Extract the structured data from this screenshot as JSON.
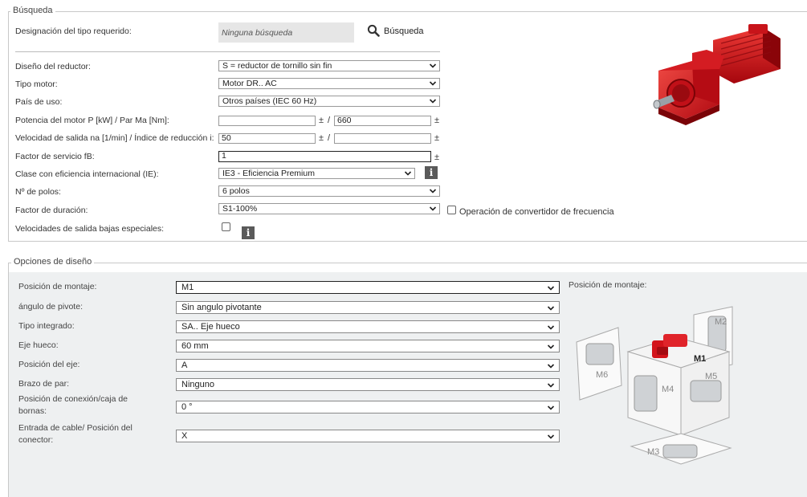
{
  "search": {
    "legend": "Búsqueda",
    "type_label": "Designación del tipo requerido:",
    "type_placeholder": "Ninguna búsqueda",
    "search_button": "Búsqueda"
  },
  "params": {
    "gear_design_label": "Diseño del reductor:",
    "gear_design_value": "S = reductor de tornillo sin fin",
    "motor_type_label": "Tipo motor:",
    "motor_type_value": "Motor DR.. AC",
    "country_label": "País de uso:",
    "country_value": "Otros países (IEC 60 Hz)",
    "motor_power_label": "Potencia del motor P [kW] / Par Ma [Nm]:",
    "motor_power_value": "",
    "torque_value": "660",
    "speed_label": "Velocidad de salida na [1/min] / Índice de reducción i:",
    "speed_value": "50",
    "ratio_value": "",
    "service_factor_label": "Factor de servicio fB:",
    "service_factor_value": "1",
    "efficiency_label": "Clase con eficiencia internacional (IE):",
    "efficiency_value": "IE3 - Eficiencia Premium",
    "poles_label": "Nº de polos:",
    "poles_value": "6 polos",
    "duty_label": "Factor de duración:",
    "duty_value": "S1-100%",
    "vfd_label": "Operación de convertidor de frecuencia",
    "low_speed_label": "Velocidades de salida bajas especiales:",
    "plus_minus": "±",
    "slash": "/",
    "info_symbol": "i"
  },
  "design": {
    "legend": "Opciones de diseño",
    "mounting_label": "Posición de montaje:",
    "mounting_value": "M1",
    "pivot_label": "ángulo de pivote:",
    "pivot_value": "Sin angulo pivotante",
    "integrated_label": "Tipo integrado:",
    "integrated_value": "SA.. Eje hueco",
    "hollow_label": "Eje hueco:",
    "hollow_value": "60 mm",
    "shaft_label": "Posición del eje:",
    "shaft_value": "A",
    "torque_arm_label": "Brazo de par:",
    "torque_arm_value": "Ninguno",
    "terminal_label": "Posición de conexión/caja de bornas:",
    "terminal_value": "0 °",
    "cable_label": "Entrada de cable/ Posición del conector:",
    "cable_value": "X",
    "diagram_title": "Posición de montaje:",
    "positions": [
      "M1",
      "M2",
      "M3",
      "M4",
      "M5",
      "M6"
    ]
  },
  "colors": {
    "accent_red": "#d3131a",
    "panel_bg": "#eef0f1"
  }
}
